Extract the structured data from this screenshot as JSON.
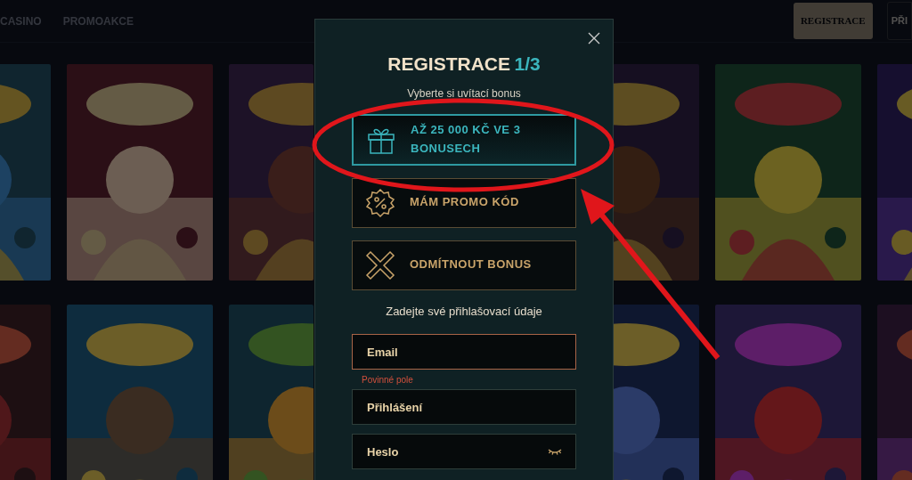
{
  "nav": {
    "links": [
      {
        "label": "CASINO"
      },
      {
        "label": "PROMOAKCE"
      }
    ],
    "buttons": [
      {
        "label": "REGISTRACE",
        "kind": "filled"
      },
      {
        "label": "PŘI",
        "kind": "outline"
      }
    ]
  },
  "modal": {
    "title": "REGISTRACE",
    "step": "1/3",
    "subtitle": "Vyberte si uvítací bonus",
    "options": [
      {
        "label": "AŽ 25 000 KČ VE 3 BONUSECH",
        "kind": "gift",
        "selected": true
      },
      {
        "label": "MÁM PROMO KÓD",
        "kind": "promo",
        "selected": false
      },
      {
        "label": "ODMÍTNOUT BONUS",
        "kind": "decline",
        "selected": false
      }
    ],
    "prompt": "Zadejte své přihlašovací údaje",
    "fields": [
      {
        "placeholder": "Email",
        "error": "Povinné pole"
      },
      {
        "placeholder": "Přihlášení"
      },
      {
        "placeholder": "Heslo",
        "kind": "password"
      }
    ]
  }
}
